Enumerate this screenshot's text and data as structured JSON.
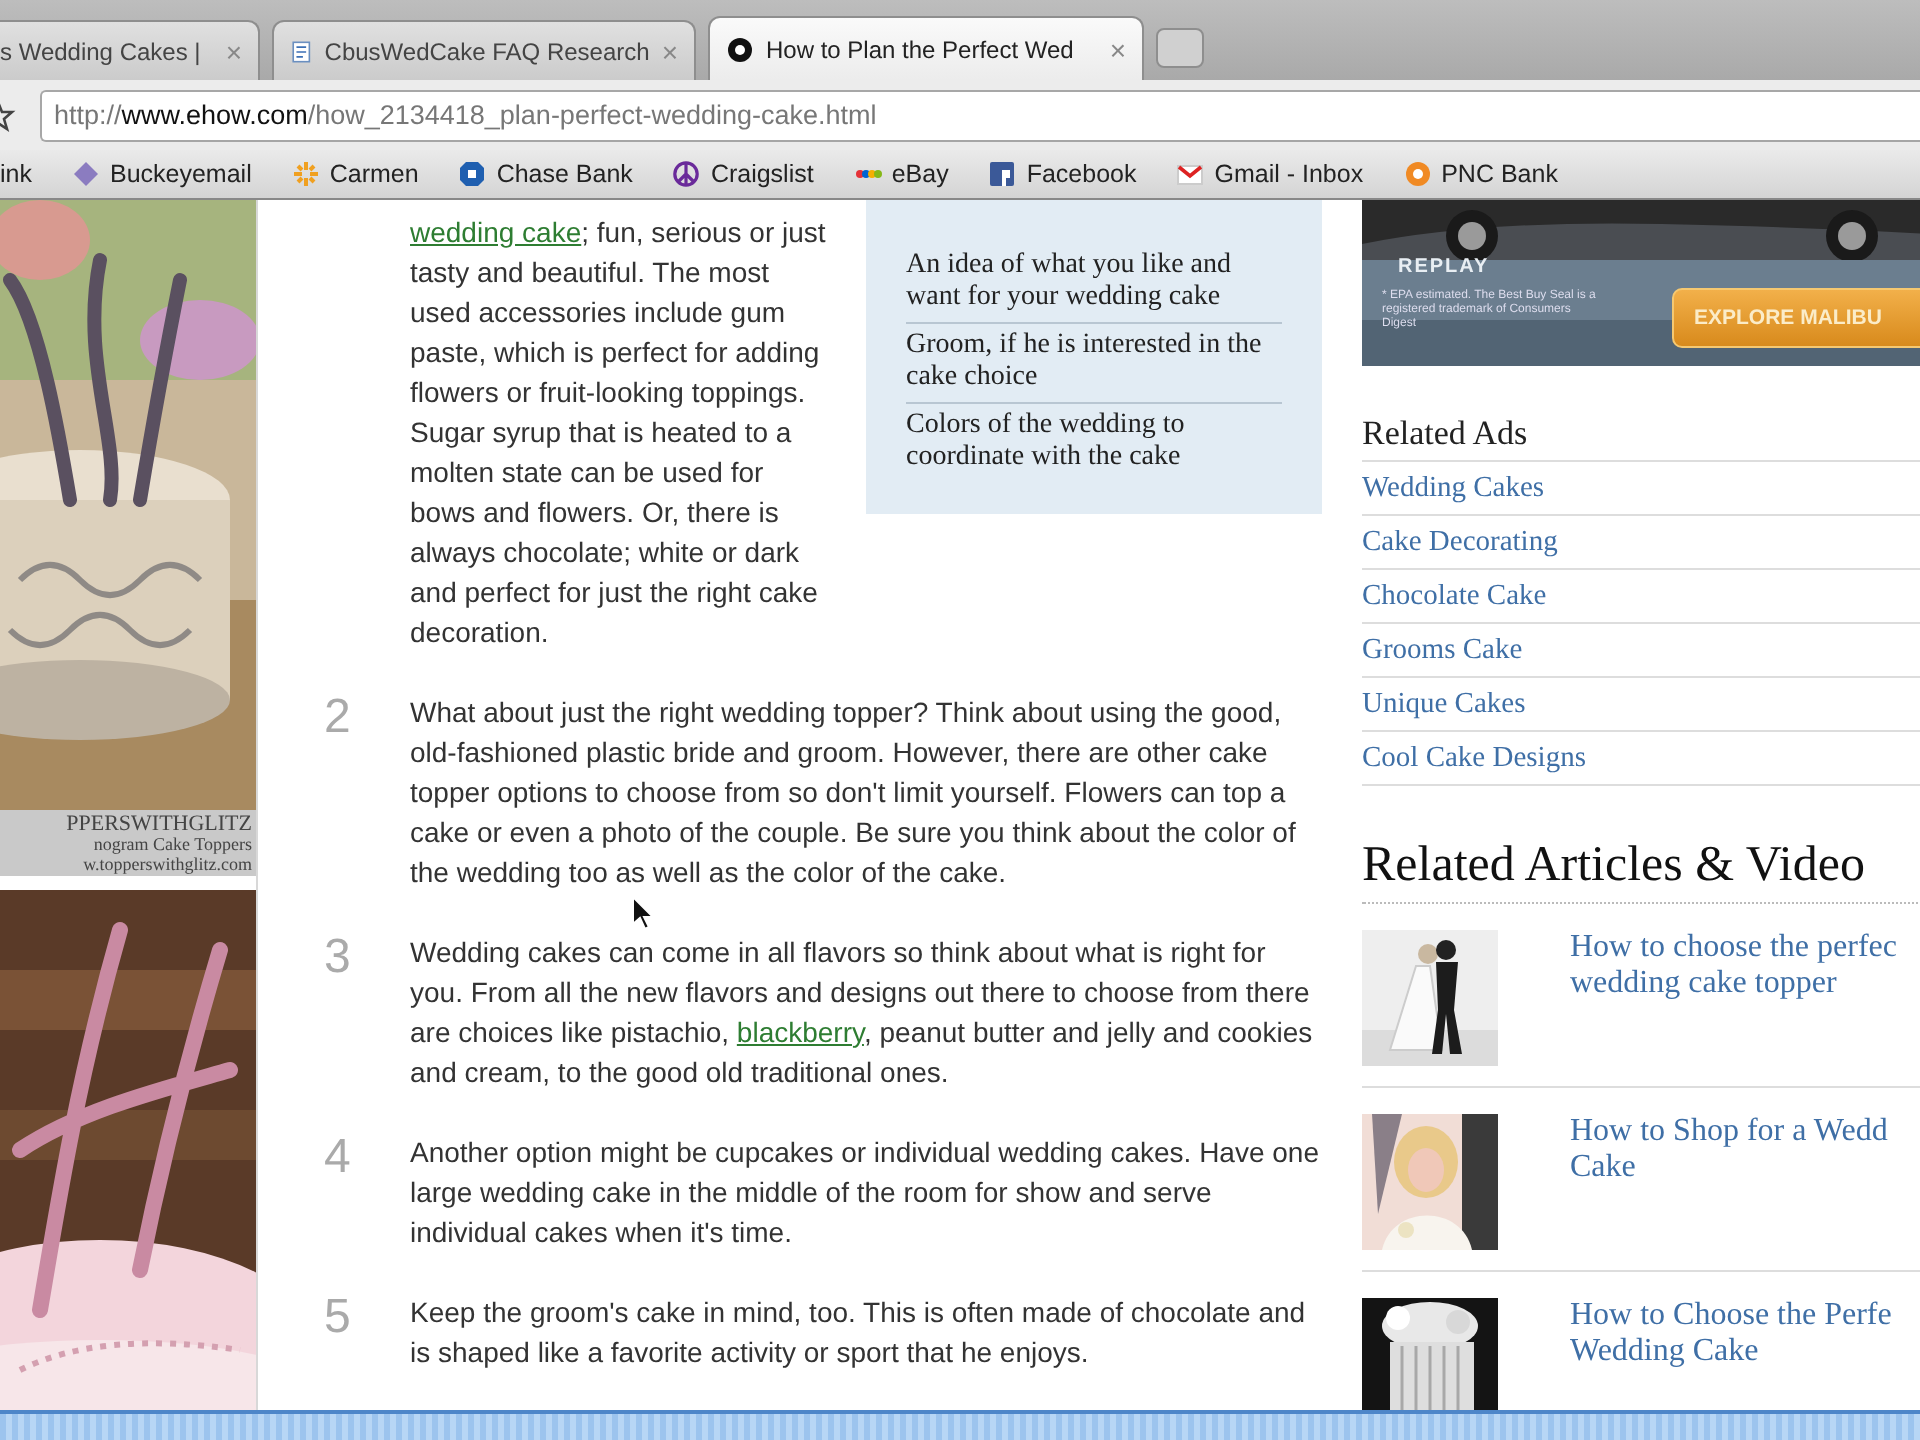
{
  "browser": {
    "tabs": [
      {
        "title": "s Wedding Cakes |",
        "selected": false
      },
      {
        "title": "CbusWedCake FAQ Research",
        "selected": false
      },
      {
        "title": "How to Plan the Perfect Wed",
        "selected": true
      }
    ],
    "close_glyph": "×",
    "address": {
      "scheme": "http://",
      "host": "www.ehow.com",
      "path": "/how_2134418_plan-perfect-wedding-cake.html"
    },
    "bookmarks": [
      {
        "label": "ink",
        "kind": "none"
      },
      {
        "label": "Buckeyemail",
        "kind": "diamond"
      },
      {
        "label": "Carmen",
        "kind": "sunburst"
      },
      {
        "label": "Chase Bank",
        "kind": "octagon"
      },
      {
        "label": "Craigslist",
        "kind": "peace"
      },
      {
        "label": "eBay",
        "kind": "dots"
      },
      {
        "label": "Facebook",
        "kind": "square"
      },
      {
        "label": "Gmail - Inbox",
        "kind": "envelope"
      },
      {
        "label": "PNC Bank",
        "kind": "circle"
      }
    ]
  },
  "left_ad": {
    "caption": [
      "PPERSWITHGLITZ",
      "nogram Cake Toppers",
      "w.topperswithglitz.com"
    ]
  },
  "article": {
    "needs": [
      "An idea of what you like and want for your wedding cake",
      "Groom, if he is interested in the cake choice",
      "Colors of the wedding to coordinate with the cake"
    ],
    "steps": [
      {
        "segments": [
          {
            "kind": "link",
            "text": "wedding cake"
          },
          {
            "kind": "text",
            "text": "; fun, serious or just tasty and beautiful. The most used accessories include gum paste, which is perfect for adding flowers or fruit-looking toppings. Sugar syrup that is heated to a molten state can be used for bows and flowers. Or, there is always chocolate; white or dark and perfect for just the right cake decoration."
          }
        ]
      },
      {
        "number": "2",
        "segments": [
          {
            "kind": "text",
            "text": "What about just the right wedding topper? Think about using the good, old-fashioned plastic bride and groom. However, there are other cake topper options to choose from so don't limit yourself. Flowers can top a cake or even a photo of the couple. Be sure you think about the color of the wedding too as well as the color of the cake."
          }
        ]
      },
      {
        "number": "3",
        "segments": [
          {
            "kind": "text",
            "text": "Wedding cakes can come in all flavors so think about what is right for you. From all the new flavors and designs out there to choose from there are choices like pistachio, "
          },
          {
            "kind": "link",
            "text": "blackberry"
          },
          {
            "kind": "text",
            "text": ", peanut butter and jelly and cookies and cream, to the good old traditional ones."
          }
        ]
      },
      {
        "number": "4",
        "segments": [
          {
            "kind": "text",
            "text": "Another option might be cupcakes or individual wedding cakes. Have one large wedding cake in the middle of the room for show and serve individual cakes when it's time."
          }
        ]
      },
      {
        "number": "5",
        "segments": [
          {
            "kind": "text",
            "text": "Keep the groom's cake in mind, too. This is often made of chocolate and is shaped like a favorite activity or sport that he enjoys."
          }
        ]
      }
    ]
  },
  "sidebar": {
    "ad": {
      "brand": "REPLAY",
      "fine_print": "* EPA estimated. The Best Buy Seal is a registered trademark of Consumers Digest",
      "button": "EXPLORE MALIBU"
    },
    "related_ads": {
      "title": "Related Ads",
      "links": [
        "Wedding Cakes",
        "Cake Decorating",
        "Chocolate Cake",
        "Grooms Cake",
        "Unique Cakes",
        "Cool Cake Designs"
      ]
    },
    "related_articles": {
      "title": "Related Articles & Video",
      "items": [
        {
          "lines": [
            "How to choose the perfec",
            "wedding cake topper"
          ]
        },
        {
          "lines": [
            "How to Shop for a Wedd",
            "Cake"
          ]
        },
        {
          "lines": [
            "How to Choose the Perfe",
            "Wedding Cake"
          ]
        }
      ]
    }
  }
}
